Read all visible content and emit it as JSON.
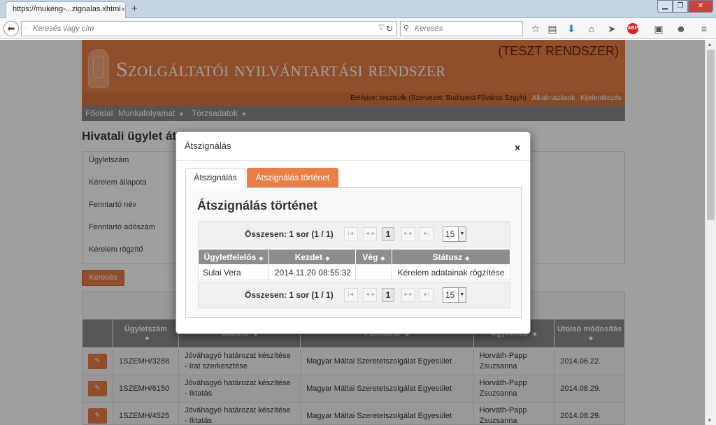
{
  "browser": {
    "tab_title": "https://mukeng-...zignalas.xhtml",
    "tab_close": "×",
    "new_tab": "+",
    "url_placeholder": "Keresés vagy cím",
    "search_placeholder": "Keresés",
    "abp_label": "ABP"
  },
  "header": {
    "site_title": "Szolgáltatói nyilvántartási rendszer",
    "test_label": "(TESZT RENDSZER)",
    "logged_in": "Belépve: tesztsvfk (Szervezet: Budapest Főváros Szgyh)",
    "apps_link": "Alkalmazások",
    "logout_link": "Kijelentkezés"
  },
  "menu": {
    "items": [
      {
        "label": "Főoldal"
      },
      {
        "label": "Munkafolyamat"
      },
      {
        "label": "Törzsadatok"
      }
    ]
  },
  "page": {
    "title": "Hivatali ügylet át",
    "fields": [
      {
        "label": "Ügyletszám"
      },
      {
        "label": "Kérelem állapota"
      },
      {
        "label": "Fenntartó név"
      },
      {
        "label": "Fenntartó adószám"
      },
      {
        "label": "Kérelem rögzítő"
      }
    ],
    "search_button": "Keresés"
  },
  "results": {
    "columns": [
      "Ügyletszám",
      "Státusz",
      "Fenntartó",
      "Ügyintéző",
      "Utolsó módosítás"
    ],
    "rows": [
      {
        "id": "1SZEMH/3288",
        "status": "Jóváhagyó határozat készítése - Irat szerkesztése",
        "owner": "Magyar Máltai Szeretetszolgálat Egyesület",
        "clerk": "Horváth-Papp Zsuzsanna",
        "modified": "2014.06.22."
      },
      {
        "id": "1SZEMH/6150",
        "status": "Jóváhagyó határozat készítése - Iktatás",
        "owner": "Magyar Máltai Szeretetszolgálat Egyesület",
        "clerk": "Horváth-Papp Zsuzsanna",
        "modified": "2014.08.29."
      },
      {
        "id": "1SZEMH/4525",
        "status": "Jóváhagyó határozat készítése - Iktatás",
        "owner": "Magyar Máltai Szeretetszolgálat Egyesület",
        "clerk": "Horváth-Papp Zsuzsanna",
        "modified": "2014.08.29."
      }
    ]
  },
  "modal": {
    "title": "Átszignálás",
    "close": "×",
    "tabs": [
      {
        "label": "Átszignálás",
        "active": false
      },
      {
        "label": "Átszignálás történet",
        "active": true
      }
    ],
    "heading": "Átszignálás történet",
    "pager": {
      "summary": "Összesen: 1 sor (1 / 1)",
      "current_page": "1",
      "page_size": "15",
      "first": "|◄",
      "prev": "◄◄",
      "next": "►►",
      "last": "►|"
    },
    "table": {
      "columns": [
        "Ügyletfelelős",
        "Kezdet",
        "Vég",
        "Státusz"
      ],
      "rows": [
        {
          "owner": "Sulai Vera",
          "start": "2014.11.20 08:55:32",
          "end": "",
          "status": "Kérelem adatainak rögzítése"
        }
      ]
    }
  },
  "colors": {
    "accent": "#e87f46",
    "header_bar": "#8d8d8d",
    "overlay": "rgba(0,0,0,0.38)"
  }
}
